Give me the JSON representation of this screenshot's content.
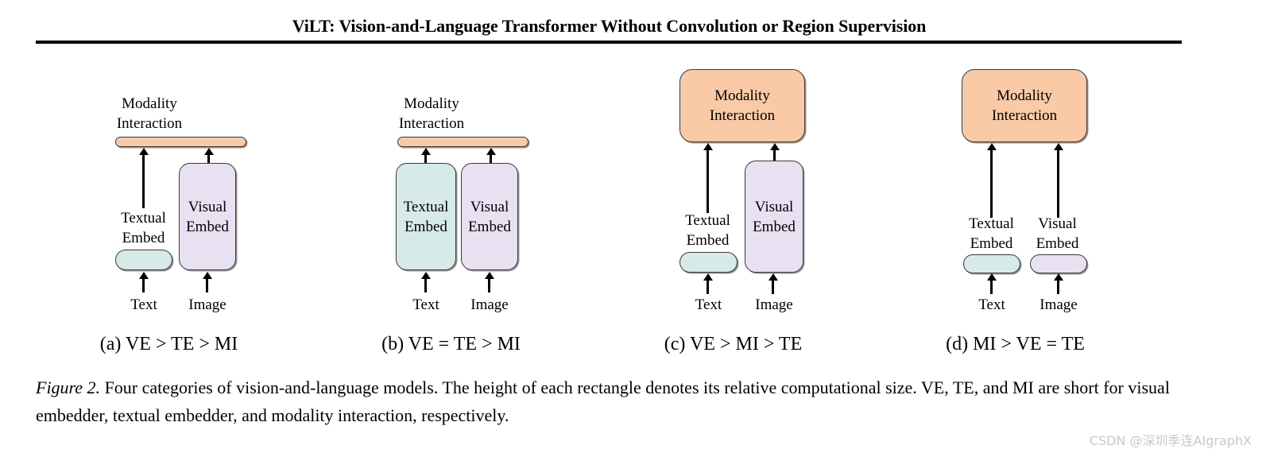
{
  "header": {
    "paper_title": "ViLT: Vision-and-Language Transformer Without Convolution or Region Supervision"
  },
  "figure": {
    "caption_number": "Figure 2.",
    "caption_text": " Four categories of vision-and-language models. The height of each rectangle denotes its relative computational size. VE, TE, and MI are short for visual embedder, textual embedder, and modality interaction, respectively.",
    "labels": {
      "modality_interaction": "Modality\nInteraction",
      "modality_interaction_l1": "Modality",
      "modality_interaction_l2": "Interaction",
      "textual_embed_l1": "Textual",
      "textual_embed_l2": "Embed",
      "visual_embed_l1": "Visual",
      "visual_embed_l2": "Embed",
      "text_input": "Text",
      "image_input": "Image"
    },
    "colors": {
      "modality_interaction": "#f9caa5",
      "textual_embed": "#d6eae7",
      "visual_embed": "#e7e1f1",
      "border": "#3a3a3a",
      "arrow": "#000000"
    },
    "panels": [
      {
        "id": "a",
        "subcaption": "(a) VE > TE > MI",
        "mi_style": "thin-bar",
        "te_style": "small-pill",
        "ve_style": "tall-box",
        "relative_sizes": {
          "VE": 3,
          "TE": 1,
          "MI": 0.5
        }
      },
      {
        "id": "b",
        "subcaption": "(b) VE = TE > MI",
        "mi_style": "thin-bar",
        "te_style": "tall-box",
        "ve_style": "tall-box",
        "relative_sizes": {
          "VE": 3,
          "TE": 3,
          "MI": 0.5
        }
      },
      {
        "id": "c",
        "subcaption": "(c) VE > MI > TE",
        "mi_style": "large-box",
        "te_style": "small-pill",
        "ve_style": "tall-box",
        "relative_sizes": {
          "VE": 3,
          "MI": 2,
          "TE": 0.6
        }
      },
      {
        "id": "d",
        "subcaption": "(d) MI > VE = TE",
        "mi_style": "large-box",
        "te_style": "small-pill",
        "ve_style": "small-pill",
        "relative_sizes": {
          "MI": 3,
          "VE": 0.6,
          "TE": 0.6
        }
      }
    ]
  },
  "watermark": {
    "text": "CSDN @深圳季连AIgraphX"
  }
}
